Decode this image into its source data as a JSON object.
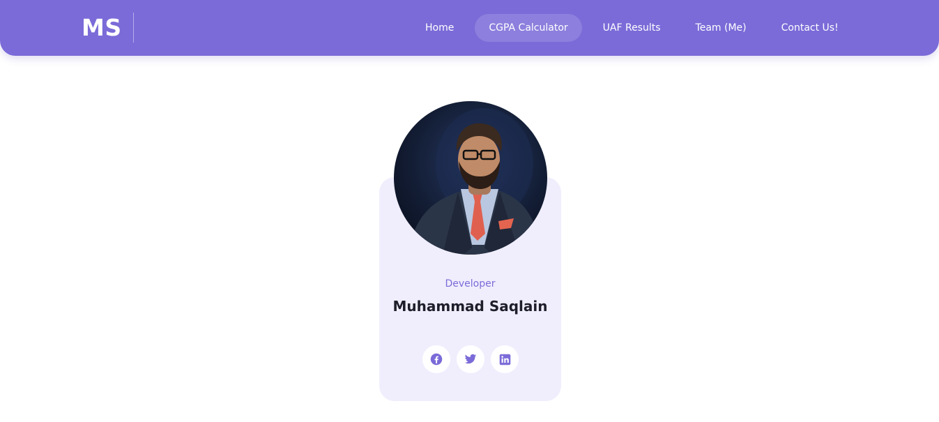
{
  "header": {
    "brand": "MS",
    "nav": [
      {
        "label": "Home",
        "active": false
      },
      {
        "label": "CGPA Calculator",
        "active": true
      },
      {
        "label": "UAF Results",
        "active": false
      },
      {
        "label": "Team (Me)",
        "active": false
      },
      {
        "label": "Contact Us!",
        "active": false
      }
    ]
  },
  "profile": {
    "role": "Developer",
    "name": "Muhammad Saqlain",
    "socials": [
      {
        "icon": "facebook-icon"
      },
      {
        "icon": "twitter-icon"
      },
      {
        "icon": "linkedin-icon"
      }
    ]
  },
  "colors": {
    "accent": "#7a6bd8",
    "card_bg": "#f0eefd",
    "text_dark": "#1e1e2a"
  }
}
